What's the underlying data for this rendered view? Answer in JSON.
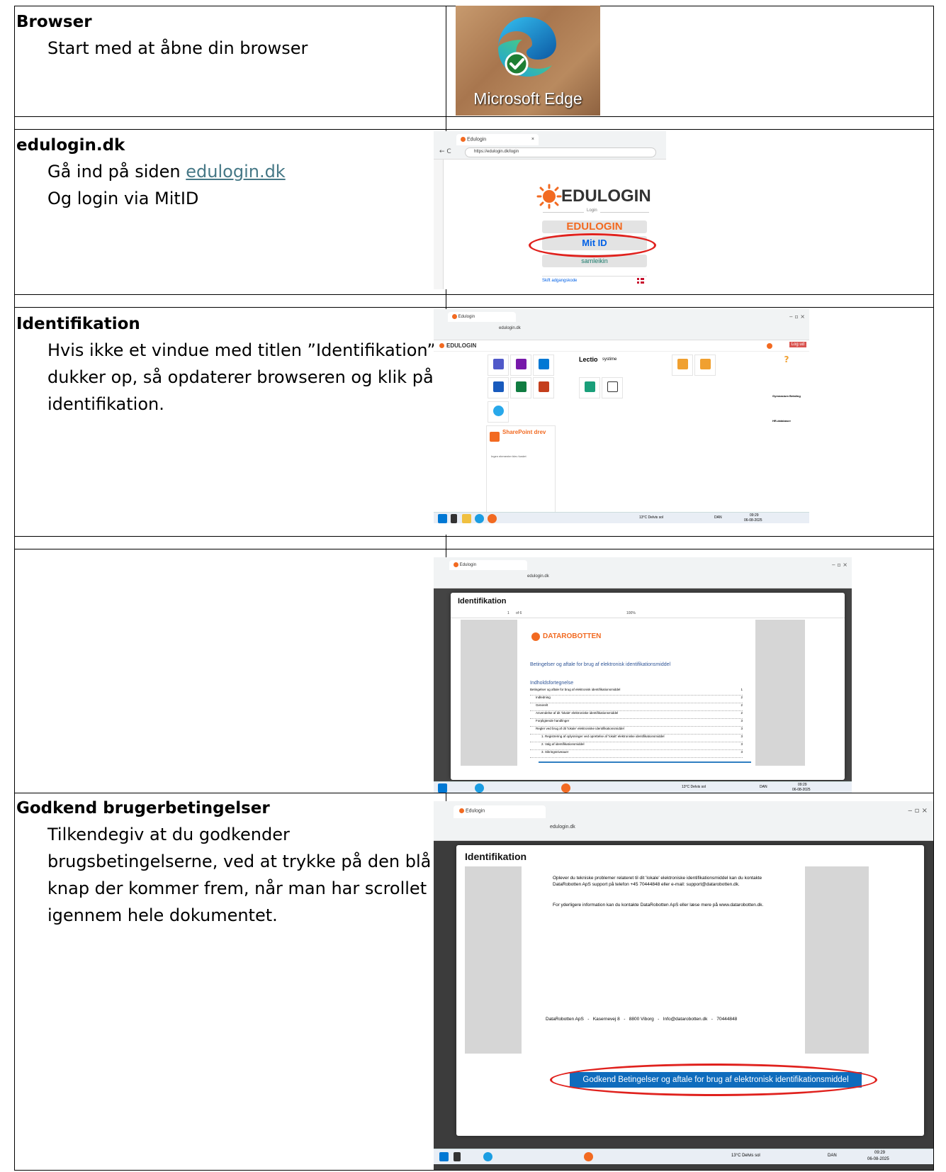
{
  "steps": [
    {
      "title": "Browser",
      "body": "Start med at åbne din browser"
    },
    {
      "title": "edulogin.dk",
      "body_prefix": "Gå ind på siden ",
      "link": "edulogin.dk",
      "body_line2": "Og login via MitID"
    },
    {
      "title": "Identifikation",
      "body": "Hvis ikke et vindue med titlen ”Identifikation” dukker op, så opdaterer browseren og klik på identifikation."
    },
    {
      "title": "Godkend brugerbetingelser",
      "body": "Tilkendegiv at du godkender brugsbetingelserne, ved at trykke på den blå knap der kommer frem, når man har scrollet igennem hele dokumentet."
    }
  ],
  "edge_shot": {
    "caption": "Microsoft Edge"
  },
  "login_shot": {
    "tab_title": "Edulogin",
    "url": "https://edulogin.dk/login",
    "logo_text": "EDULOGIN",
    "divider_label": "Login",
    "options": [
      "EDULOGIN",
      "Mit ID",
      "samleikin"
    ],
    "change_link": "Skift adgangskode"
  },
  "portal_shot": {
    "tab_title": "Edulogin",
    "url": "edulogin.dk",
    "logo_text": "EDULOGIN",
    "logout_label": "Log ud",
    "lectio_label": "Lectio",
    "systime_label": "systime",
    "sharepoint_label": "SharePoint drev",
    "empty_note": "Ingen elementer blev fundet",
    "help_label": "?",
    "side_items": [
      "Gymnasium Betaling",
      "HR-databaser"
    ],
    "weather": "13°C Delvis sol",
    "lang": "DAN",
    "clock_time": "09:29",
    "clock_date": "06-08-2025"
  },
  "pdf_shot": {
    "tab_title": "Edulogin",
    "url": "edulogin.dk",
    "modal_title": "Identifikation",
    "page_info": "1",
    "page_of": "of 6",
    "zoom": "100%",
    "brand": "DATAROBOTTEN",
    "heading": "Betingelser og aftale for brug af elektronisk identifikationsmiddel",
    "toc_heading": "Indholdsfortegnelse",
    "toc": [
      {
        "t": "Betingelser og aftale for brug af elektronisk identifikationsmiddel",
        "p": "1",
        "lvl": 0
      },
      {
        "t": "Indledning",
        "p": "2",
        "lvl": 1
      },
      {
        "t": "Generelt",
        "p": "2",
        "lvl": 1
      },
      {
        "t": "Anvendelse af dit 'lokale' elektroniske identifikationsmiddel",
        "p": "2",
        "lvl": 1
      },
      {
        "t": "Forpligtende handlinger",
        "p": "3",
        "lvl": 1
      },
      {
        "t": "Regler ved brug af dit 'lokale' elektroniske identifikationsmiddel",
        "p": "3",
        "lvl": 1
      },
      {
        "t": "1.   Registrering af oplysninger ved oprettelse af 'lokalt' elektroniske identifikationsmiddel",
        "p": "3",
        "lvl": 2
      },
      {
        "t": "2.   Valg af identifikationsmiddel",
        "p": "3",
        "lvl": 2
      },
      {
        "t": "3.   Sikringsniveauer",
        "p": "3",
        "lvl": 2
      }
    ],
    "weather": "13°C Delvis sol",
    "lang": "DAN",
    "clock_time": "09:29",
    "clock_date": "06-08-2025"
  },
  "accept_shot": {
    "tab_title": "Edulogin",
    "url": "edulogin.dk",
    "modal_title": "Identifikation",
    "para1": "Oplever du tekniske problemer relateret til dit 'lokale' elektroniske identifikationsmiddel kan du kontakte DataRobotten ApS support på telefon +45 70444848 eller e-mail: support@datarobotten.dk.",
    "para2": "For yderligere information kan du kontakte DataRobotten ApS eller læse mere på www.datarobotten.dk.",
    "footer": "DataRobotten ApS   -   Kasernevej 8   -   8800 Viborg   -   Info@datarobotten.dk   -   70444848",
    "accept_button": "Godkend Betingelser og aftale for brug af elektronisk identifikationsmiddel",
    "weather": "13°C Delvis sol",
    "lang": "DAN",
    "clock_time": "09:29",
    "clock_date": "06-08-2025"
  },
  "colors": {
    "accent_orange": "#f26a21",
    "link_blue": "#467886",
    "accept_blue": "#0f6cbd",
    "highlight_red": "#e0211d"
  }
}
